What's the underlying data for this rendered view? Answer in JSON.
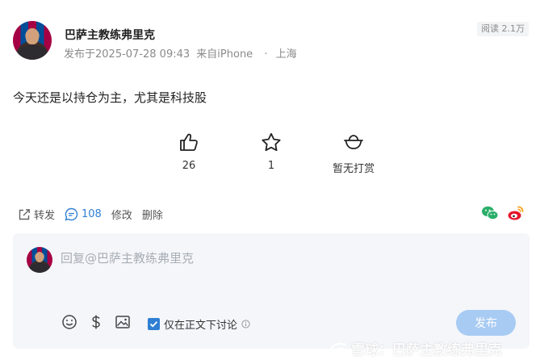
{
  "author": {
    "name": "巴萨主教练弗里克"
  },
  "meta": {
    "published": "发布于2025-07-28 09:43",
    "source": "来自iPhone",
    "separator": "·",
    "location": "上海"
  },
  "read_badge": "阅读 2.1万",
  "post": {
    "text": "今天还是以持仓为主，尤其是科技股"
  },
  "actions": {
    "like": {
      "icon": "thumbs-up-icon",
      "count": "26"
    },
    "favorite": {
      "icon": "star-icon",
      "count": "1"
    },
    "reward": {
      "icon": "ingot-icon",
      "label": "暂无打赏"
    }
  },
  "toolbar": {
    "repost": "转发",
    "comments": "108",
    "edit": "修改",
    "delete": "删除"
  },
  "share": {
    "wechat_icon": "wechat-icon",
    "weibo_icon": "weibo-icon",
    "wechat_color": "#2aae67",
    "weibo_color": "#e6162d"
  },
  "reply": {
    "placeholder": "回复@巴萨主教练弗里克",
    "tools": [
      "emoji-icon",
      "dollar-icon",
      "image-icon"
    ],
    "checkbox_label": "仅在正文下讨论",
    "checkbox_checked": true,
    "publish": "发布"
  },
  "watermark": {
    "prefix": "雪球：",
    "name": "巴萨主教练弗里克"
  },
  "colors": {
    "accent": "#2f7fd3",
    "publish_disabled": "#a8cbf3",
    "muted": "#8a8a8a"
  }
}
